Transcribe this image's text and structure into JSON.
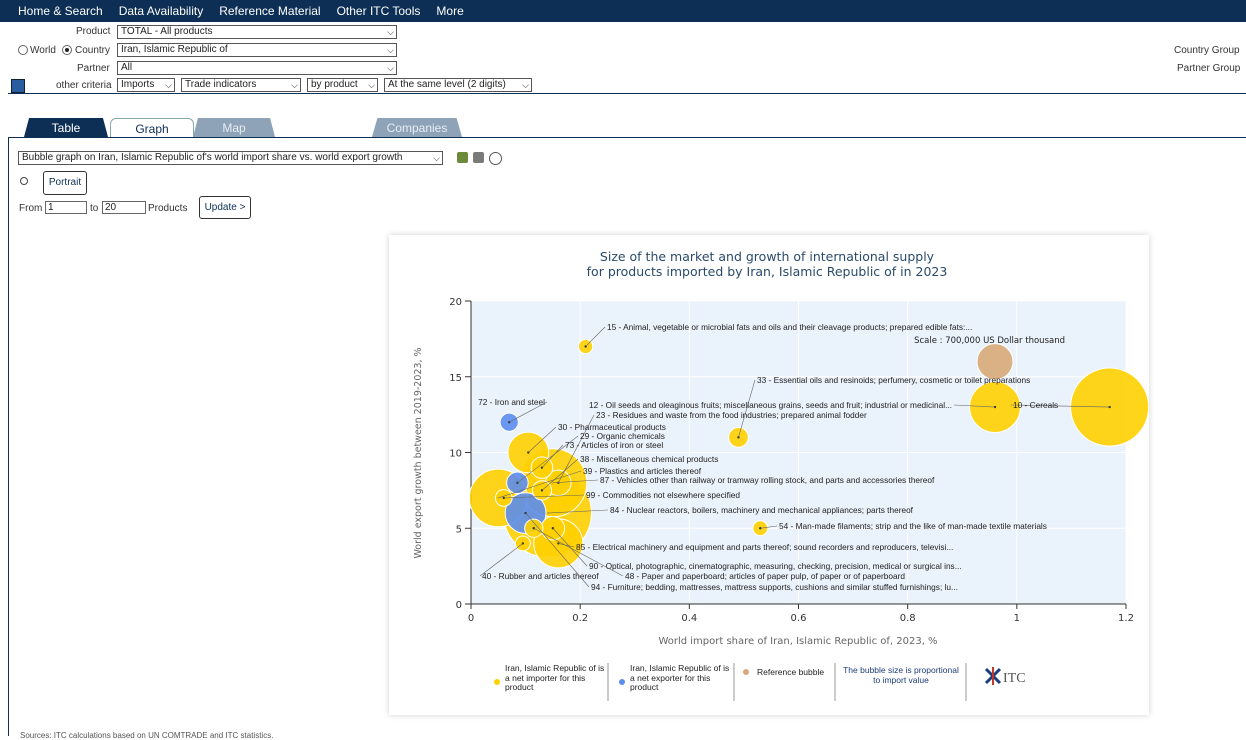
{
  "nav": [
    "Home & Search",
    "Data Availability",
    "Reference Material",
    "Other ITC Tools",
    "More"
  ],
  "filters": {
    "product_label": "Product",
    "product_value": "TOTAL - All products",
    "world_label": "World",
    "country_label": "Country",
    "country_value": "Iran, Islamic Republic of",
    "partner_label": "Partner",
    "partner_value": "All",
    "other_label": "other criteria",
    "flow_value": "Imports",
    "indicator_value": "Trade indicators",
    "by_value": "by product",
    "level_value": "At the same level (2 digits)",
    "country_group": "Country Group",
    "partner_group": "Partner Group"
  },
  "tabs": {
    "table": "Table",
    "graph": "Graph",
    "map": "Map",
    "companies": "Companies"
  },
  "graph_controls": {
    "graph_select": "Bubble graph on Iran, Islamic Republic of's world import share vs. world export growth",
    "portrait": "Portrait",
    "from_label": "From",
    "from_value": "1",
    "to_label": "to",
    "to_value": "20",
    "products_label": "Products",
    "update": "Update >"
  },
  "legend": {
    "importer": "Iran, Islamic Republic of is a net importer for this product",
    "exporter": "Iran, Islamic Republic of is a net exporter for this product",
    "reference": "Reference bubble",
    "size_note": "The bubble size is proportional to import value",
    "logo": "ITC"
  },
  "footer": "Sources: ITC calculations based on UN COMTRADE and ITC statistics.",
  "colors": {
    "importer": "#ffd000",
    "exporter": "#5b8def",
    "reference": "#d8a878",
    "plot_bg": "#eaf2fb",
    "nav": "#0d2f55"
  },
  "chart_data": {
    "type": "scatter",
    "title_line1": "Size of the market and growth of international supply",
    "title_line2": "for products imported by Iran, Islamic Republic of in 2023",
    "xlabel": "World import share of Iran, Islamic Republic of, 2023, %",
    "ylabel": "World export growth between 2019-2023, %",
    "xlim": [
      0,
      1.2
    ],
    "ylim": [
      0,
      20
    ],
    "xticks": [
      "0",
      "0.2",
      "0.4",
      "0.6",
      "0.8",
      "1",
      "1.2"
    ],
    "yticks": [
      "0",
      "5",
      "10",
      "15",
      "20"
    ],
    "scale_note": "Scale : 700,000 US Dollar thousand",
    "reference_bubble": {
      "x": 0.96,
      "y": 16,
      "size": 700000
    },
    "points": [
      {
        "label": "15 - Animal, vegetable or microbial fats and oils and their cleavage products; prepared edible fats:...",
        "x": 0.21,
        "y": 17,
        "size": 110000,
        "type": "importer"
      },
      {
        "label": "33 - Essential oils and resinoids; perfumery, cosmetic or toilet preparations",
        "x": 0.49,
        "y": 11,
        "size": 210000,
        "type": "importer"
      },
      {
        "label": "10 - Cereals",
        "x": 1.17,
        "y": 13,
        "size": 3300000,
        "type": "importer"
      },
      {
        "label": "12 - Oil seeds and oleaginous fruits; miscellaneous grains, seeds and fruit; industrial or medicinal...",
        "x": 0.96,
        "y": 13,
        "size": 1400000,
        "type": "importer"
      },
      {
        "label": "23 - Residues and waste from the food industries; prepared animal fodder",
        "x": 0.16,
        "y": 8,
        "size": 350000,
        "type": "importer"
      },
      {
        "label": "72 - Iron and steel",
        "x": 0.07,
        "y": 12,
        "size": 180000,
        "type": "exporter"
      },
      {
        "label": "30 - Pharmaceutical products",
        "x": 0.105,
        "y": 10,
        "size": 900000,
        "type": "importer"
      },
      {
        "label": "29 - Organic chemicals",
        "x": 0.085,
        "y": 8,
        "size": 250000,
        "type": "exporter"
      },
      {
        "label": "73 - Articles of iron or steel",
        "x": 0.13,
        "y": 9,
        "size": 250000,
        "type": "importer"
      },
      {
        "label": "38 - Miscellaneous chemical products",
        "x": 0.13,
        "y": 7.5,
        "size": 200000,
        "type": "importer"
      },
      {
        "label": "39 - Plastics and articles thereof",
        "x": 0.05,
        "y": 7,
        "size": 1800000,
        "type": "importer"
      },
      {
        "label": "87 - Vehicles other than railway or tramway rolling stock, and parts and accessories thereof",
        "x": 0.15,
        "y": 8,
        "size": 2500000,
        "type": "importer"
      },
      {
        "label": "99 - Commodities not elsewhere specified",
        "x": 0.06,
        "y": 7,
        "size": 150000,
        "type": "importer"
      },
      {
        "label": "84 - Nuclear reactors, boilers, machinery and mechanical appliances; parts thereof",
        "x": 0.14,
        "y": 6,
        "size": 4200000,
        "type": "importer"
      },
      {
        "label": "54 - Man-made filaments; strip and the like of man-made textile materials",
        "x": 0.53,
        "y": 5,
        "size": 120000,
        "type": "importer"
      },
      {
        "label": "85 - Electrical machinery and equipment and parts thereof; sound recorders and reproducers, televisi...",
        "x": 0.16,
        "y": 4,
        "size": 1300000,
        "type": "importer"
      },
      {
        "label": "90 - Optical, photographic, cinematographic, measuring, checking, precision, medical or surgical ins...",
        "x": 0.15,
        "y": 5,
        "size": 300000,
        "type": "importer"
      },
      {
        "label": "40 - Rubber and articles thereof",
        "x": 0.095,
        "y": 4,
        "size": 120000,
        "type": "importer"
      },
      {
        "label": "48 - Paper and paperboard; articles of paper pulp, of paper or of paperboard",
        "x": 0.115,
        "y": 5,
        "size": 180000,
        "type": "importer"
      },
      {
        "label": "94 - Furniture; bedding, mattresses, mattress supports, cushions and similar stuffed furnishings; lu...",
        "x": 0.1,
        "y": 6,
        "size": 900000,
        "type": "exporter"
      }
    ]
  }
}
